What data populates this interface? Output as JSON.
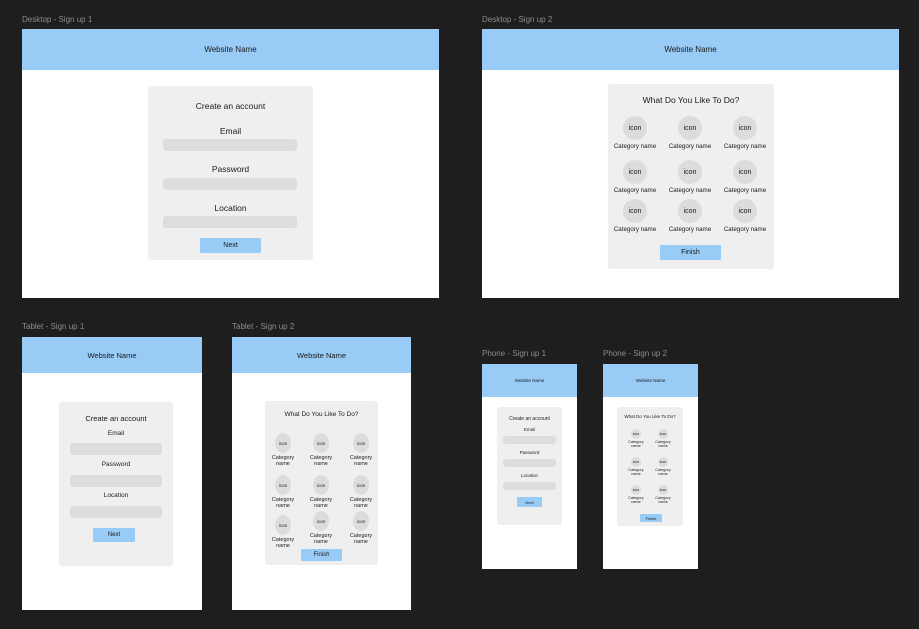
{
  "colors": {
    "canvas": "#1e1e1e",
    "frame": "#ffffff",
    "header": "#99cbf7",
    "card": "#efefef",
    "field": "#dddddd",
    "button": "#99cbf7",
    "label": "#8c8c8c"
  },
  "frames": {
    "desktop_signup_1": {
      "label": "Desktop - Sign up 1",
      "site_name": "Website Name",
      "form_title": "Create an account",
      "email_label": "Email",
      "password_label": "Password",
      "location_label": "Location",
      "button": "Next"
    },
    "desktop_signup_2": {
      "label": "Desktop - Sign up 2",
      "site_name": "Website Name",
      "title": "What Do You Like To Do?",
      "icon_text": "icon",
      "category_label": "Category name",
      "button": "Finish"
    },
    "tablet_signup_1": {
      "label": "Tablet - Sign up 1",
      "site_name": "Website Name",
      "form_title": "Create an account",
      "email_label": "Email",
      "password_label": "Password",
      "location_label": "Location",
      "button": "Next"
    },
    "tablet_signup_2": {
      "label": "Tablet - Sign up 2",
      "site_name": "Website Name",
      "title": "What Do You Like To Do?",
      "icon_text": "icon",
      "category_label": "Category name",
      "button": "Finish"
    },
    "phone_signup_1": {
      "label": "Phone - Sign up 1",
      "site_name": "Website Name",
      "form_title": "Create an account",
      "email_label": "Email",
      "password_label": "Password",
      "location_label": "Location",
      "button": "Next"
    },
    "phone_signup_2": {
      "label": "Phone - Sign up 2",
      "site_name": "Website Name",
      "title": "What Do You Like To Do?",
      "icon_text": "icon",
      "category_label": "Category name",
      "button": "Finish"
    }
  }
}
